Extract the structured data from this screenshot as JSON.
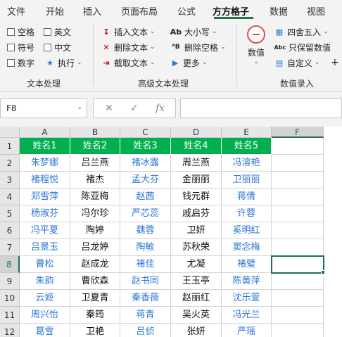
{
  "menu": {
    "tabs": [
      "文件",
      "开始",
      "插入",
      "页面布局",
      "公式",
      "方方格子",
      "数据",
      "视图"
    ],
    "active_tab": "方方格子"
  },
  "ribbon": {
    "text_processing": {
      "label": "文本处理",
      "checkboxes": [
        "空格",
        "英文",
        "符号",
        "中文",
        "数字"
      ],
      "execute": "执行"
    },
    "advanced_text": {
      "label": "高级文本处理",
      "insert_text": "插入文本",
      "delete_text": "删除文本",
      "extract_text": "截取文本",
      "case": "大小写",
      "delete_spaces": "删除空格",
      "more": "更多"
    },
    "numeric_input": {
      "label": "数值录入",
      "numeric": "数值",
      "rounding": "四舍五入",
      "keep_values": "只保留数值",
      "custom": "自定义"
    }
  },
  "formula_bar": {
    "cell_ref": "F8",
    "fx": "fx",
    "cancel": "✕",
    "confirm": "✓",
    "formula": ""
  },
  "sheet": {
    "columns": [
      "A",
      "B",
      "C",
      "D",
      "E",
      "F"
    ],
    "rows": [
      "1",
      "2",
      "3",
      "4",
      "5",
      "6",
      "7",
      "8",
      "9",
      "10",
      "11",
      "12"
    ],
    "selected_cell": "F8",
    "headers": [
      "姓名1",
      "姓名2",
      "姓名3",
      "姓名4",
      "姓名5"
    ],
    "data": [
      [
        "朱梦娜",
        "吕兰燕",
        "褚冰露",
        "周兰燕",
        "冯溶艳"
      ],
      [
        "褚程悦",
        "褚杰",
        "孟大芬",
        "金丽丽",
        "卫丽丽"
      ],
      [
        "郑雪萍",
        "陈亚梅",
        "赵茜",
        "钱元群",
        "蒋倩"
      ],
      [
        "杨淑芬",
        "冯尔珍",
        "严芯蕊",
        "戚启芬",
        "许蓉"
      ],
      [
        "冯平夏",
        "陶婷",
        "魏蓉",
        "卫妍",
        "奚明红"
      ],
      [
        "吕景玉",
        "吕龙婷",
        "陶敏",
        "苏秋荣",
        "窦念梅"
      ],
      [
        "曹松",
        "赵成龙",
        "褚佳",
        "尤凝",
        "褚璧"
      ],
      [
        "朱韵",
        "曹欣森",
        "赵书同",
        "王玉亭",
        "陈黄萍"
      ],
      [
        "云姬",
        "卫夏青",
        "秦香薇",
        "赵丽红",
        "沈乐萱"
      ],
      [
        "周兴怡",
        "秦筠",
        "蒋青",
        "吴火英",
        "冯光兰"
      ],
      [
        "葛雪",
        "卫艳",
        "吕侦",
        "张妍",
        "严瑶"
      ]
    ],
    "colors": {
      "header_fill": "#00b050",
      "header_text": "#ffffff",
      "blue_text": "#2e75d6",
      "black_text": "#111111",
      "selection": "#217346"
    }
  }
}
